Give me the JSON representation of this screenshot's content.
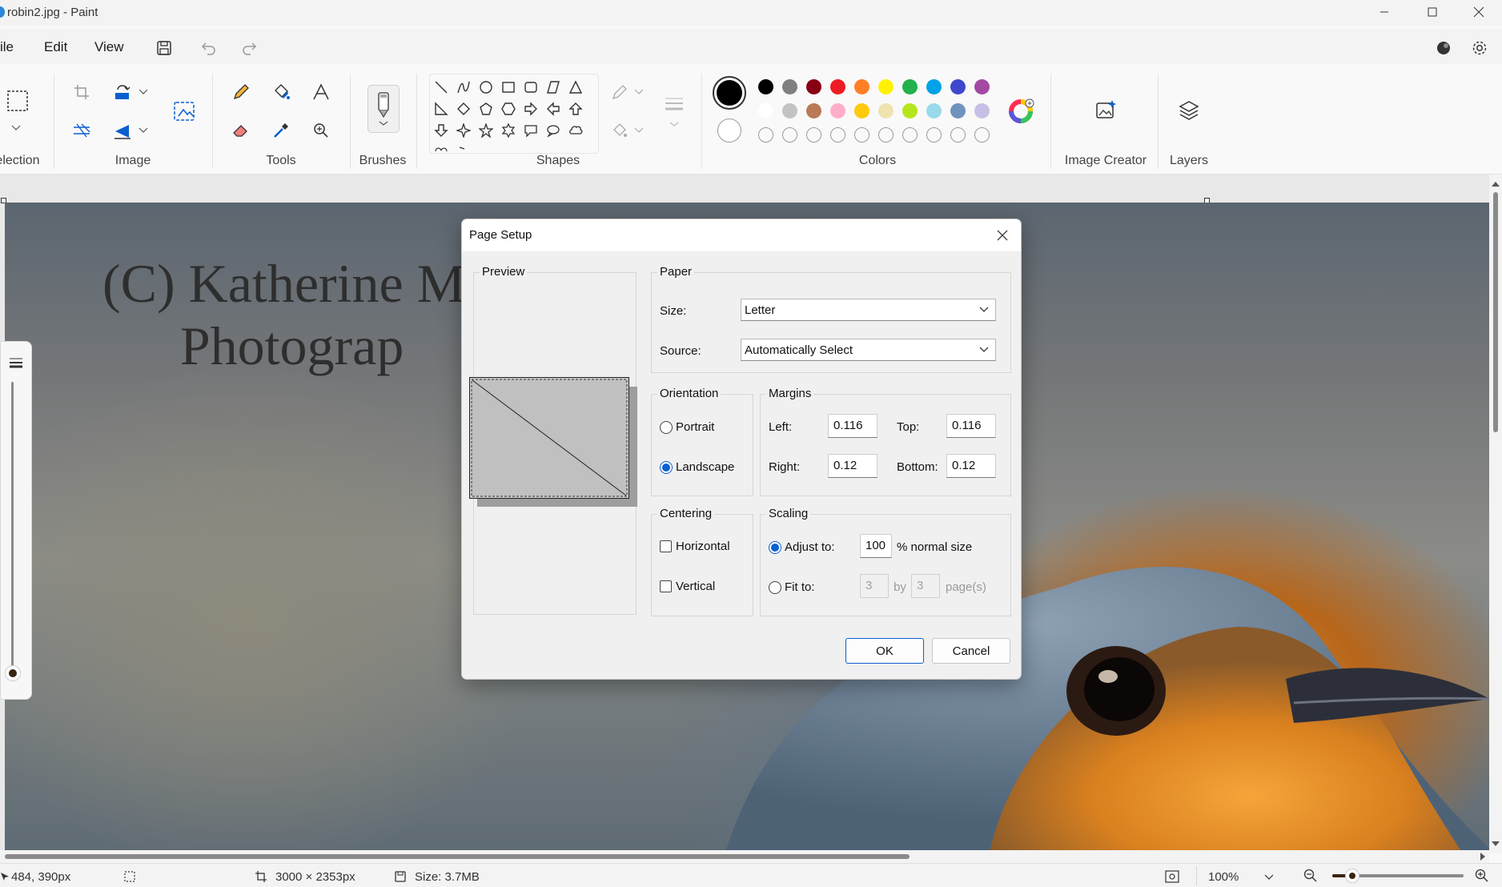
{
  "window": {
    "title": "robin2.jpg - Paint"
  },
  "menu": {
    "file": "ile",
    "edit": "Edit",
    "view": "View"
  },
  "ribbon": {
    "groups": {
      "selection": "election",
      "image": "Image",
      "tools": "Tools",
      "brushes": "Brushes",
      "shapes": "Shapes",
      "colors": "Colors",
      "image_creator": "Image Creator",
      "layers": "Layers"
    },
    "colors": {
      "primary": "#000000",
      "secondary": "#ffffff",
      "row1": [
        "#000000",
        "#7f7f7f",
        "#880015",
        "#ed1c24",
        "#ff7f27",
        "#fff200",
        "#22b14c",
        "#00a2e8",
        "#3f48cc",
        "#a349a4"
      ],
      "row2": [
        "#ffffff",
        "#c3c3c3",
        "#b97a57",
        "#ffaec9",
        "#ffc90e",
        "#efe4b0",
        "#b5e61d",
        "#99d9ea",
        "#7092be",
        "#c8bfe7"
      ]
    }
  },
  "canvas": {
    "watermark_line1": "(C) Katherine M",
    "watermark_line2": "Photograp"
  },
  "dialog": {
    "title": "Page Setup",
    "preview_label": "Preview",
    "paper": {
      "legend": "Paper",
      "size_label": "Size:",
      "size_value": "Letter",
      "source_label": "Source:",
      "source_value": "Automatically Select"
    },
    "orientation": {
      "legend": "Orientation",
      "portrait": "Portrait",
      "landscape": "Landscape",
      "selected": "landscape"
    },
    "margins": {
      "legend": "Margins",
      "left_label": "Left:",
      "left_value": "0.116",
      "top_label": "Top:",
      "top_value": "0.116",
      "right_label": "Right:",
      "right_value": "0.12",
      "bottom_label": "Bottom:",
      "bottom_value": "0.12"
    },
    "centering": {
      "legend": "Centering",
      "horizontal": "Horizontal",
      "vertical": "Vertical"
    },
    "scaling": {
      "legend": "Scaling",
      "adjust_label": "Adjust to:",
      "adjust_value": "100",
      "adjust_suffix": "% normal size",
      "fit_label": "Fit to:",
      "fit_w": "3",
      "by_label": "by",
      "fit_h": "3",
      "pages_label": "page(s)"
    },
    "ok": "OK",
    "cancel": "Cancel"
  },
  "status": {
    "cursor": "484, 390px",
    "dimensions": "3000 × 2353px",
    "size": "Size: 3.7MB",
    "zoom": "100%"
  }
}
